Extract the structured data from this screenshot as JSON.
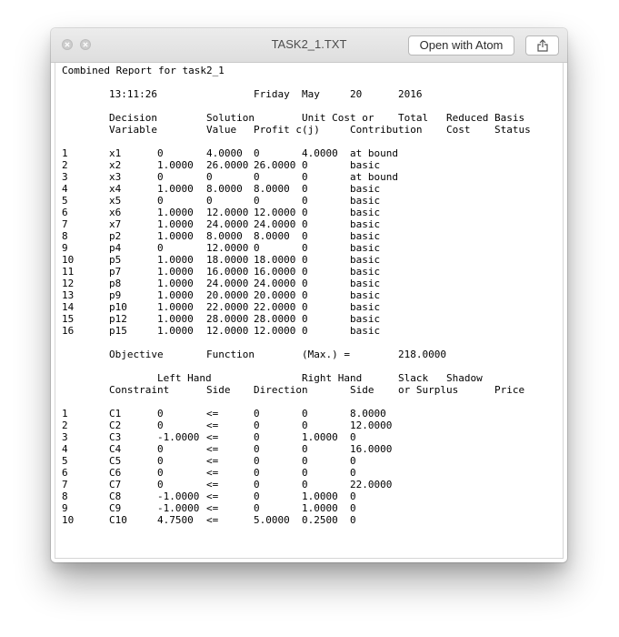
{
  "window": {
    "title": "TASK2_1.TXT",
    "open_with_label": "Open with Atom",
    "icons": {
      "close": "close-icon",
      "minimize": "minimize-icon",
      "share": "share-icon"
    }
  },
  "report": {
    "heading": "Combined Report for task2_1",
    "datetime": {
      "time": "13:11:26",
      "day": "Friday",
      "month": "May",
      "date": "20",
      "year": "2016"
    },
    "decision_header": {
      "row1": [
        "Decision",
        "Solution",
        "Unit Cost or",
        "Total",
        "Reduced",
        "Basis"
      ],
      "row2": [
        "Variable",
        "Value",
        "Profit c(j)",
        "Contribution",
        "Cost",
        "Status"
      ]
    },
    "decision_rows": [
      [
        "1",
        "x1",
        "0",
        "4.0000",
        "0",
        "4.0000",
        "at bound"
      ],
      [
        "2",
        "x2",
        "1.0000",
        "26.0000",
        "26.0000",
        "0",
        "basic"
      ],
      [
        "3",
        "x3",
        "0",
        "0",
        "0",
        "0",
        "at bound"
      ],
      [
        "4",
        "x4",
        "1.0000",
        "8.0000",
        "8.0000",
        "0",
        "basic"
      ],
      [
        "5",
        "x5",
        "0",
        "0",
        "0",
        "0",
        "basic"
      ],
      [
        "6",
        "x6",
        "1.0000",
        "12.0000",
        "12.0000",
        "0",
        "basic"
      ],
      [
        "7",
        "x7",
        "1.0000",
        "24.0000",
        "24.0000",
        "0",
        "basic"
      ],
      [
        "8",
        "p2",
        "1.0000",
        "8.0000",
        "8.0000",
        "0",
        "basic"
      ],
      [
        "9",
        "p4",
        "0",
        "12.0000",
        "0",
        "0",
        "basic"
      ],
      [
        "10",
        "p5",
        "1.0000",
        "18.0000",
        "18.0000",
        "0",
        "basic"
      ],
      [
        "11",
        "p7",
        "1.0000",
        "16.0000",
        "16.0000",
        "0",
        "basic"
      ],
      [
        "12",
        "p8",
        "1.0000",
        "24.0000",
        "24.0000",
        "0",
        "basic"
      ],
      [
        "13",
        "p9",
        "1.0000",
        "20.0000",
        "20.0000",
        "0",
        "basic"
      ],
      [
        "14",
        "p10",
        "1.0000",
        "22.0000",
        "22.0000",
        "0",
        "basic"
      ],
      [
        "15",
        "p12",
        "1.0000",
        "28.0000",
        "28.0000",
        "0",
        "basic"
      ],
      [
        "16",
        "p15",
        "1.0000",
        "12.0000",
        "12.0000",
        "0",
        "basic"
      ]
    ],
    "objective": {
      "label1": "Objective",
      "label2": "Function",
      "label3": "(Max.) =",
      "value": "218.0000"
    },
    "constraint_header": {
      "row1": [
        "Left Hand",
        "Right Hand",
        "Slack",
        "Shadow"
      ],
      "row2": [
        "Constraint",
        "Side",
        "Direction",
        "Side",
        "or Surplus",
        "Price"
      ]
    },
    "constraint_rows": [
      [
        "1",
        "C1",
        "0",
        "<=",
        "0",
        "0",
        "8.0000"
      ],
      [
        "2",
        "C2",
        "0",
        "<=",
        "0",
        "0",
        "12.0000"
      ],
      [
        "3",
        "C3",
        "-1.0000",
        "<=",
        "0",
        "1.0000",
        "0"
      ],
      [
        "4",
        "C4",
        "0",
        "<=",
        "0",
        "0",
        "16.0000"
      ],
      [
        "5",
        "C5",
        "0",
        "<=",
        "0",
        "0",
        "0"
      ],
      [
        "6",
        "C6",
        "0",
        "<=",
        "0",
        "0",
        "0"
      ],
      [
        "7",
        "C7",
        "0",
        "<=",
        "0",
        "0",
        "22.0000"
      ],
      [
        "8",
        "C8",
        "-1.0000",
        "<=",
        "0",
        "1.0000",
        "0"
      ],
      [
        "9",
        "C9",
        "-1.0000",
        "<=",
        "0",
        "1.0000",
        "0"
      ],
      [
        "10",
        "C10",
        "4.7500",
        "<=",
        "5.0000",
        "0.2500",
        "0"
      ]
    ]
  }
}
